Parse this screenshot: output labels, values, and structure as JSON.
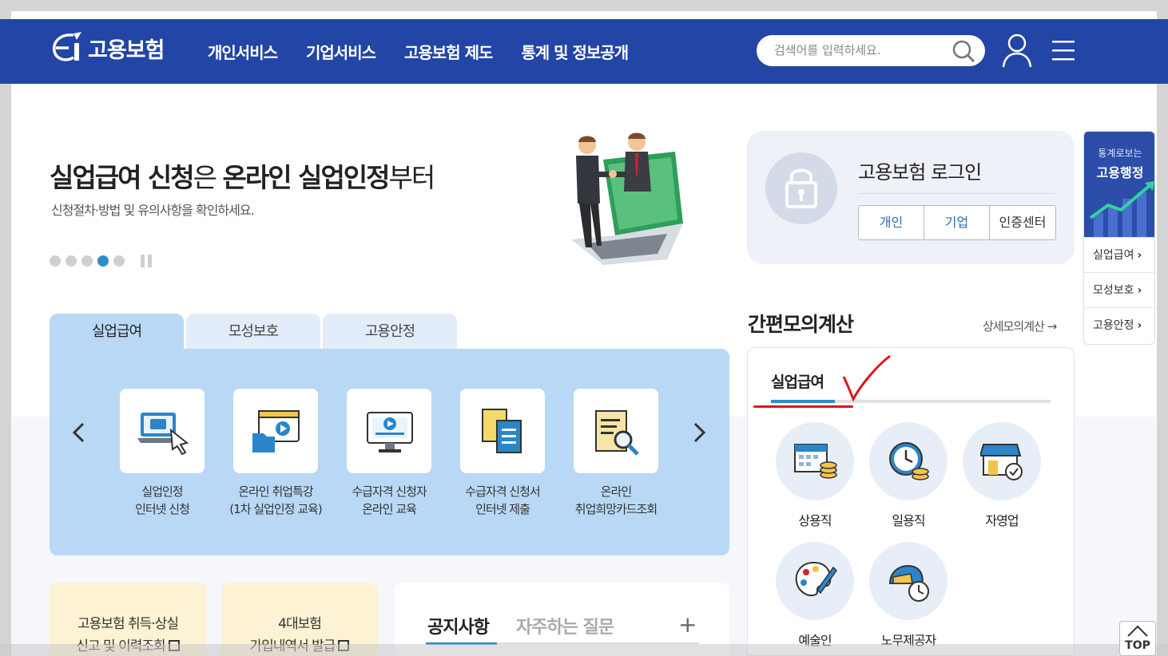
{
  "header": {
    "logo_text": "고용보험",
    "nav": [
      "개인서비스",
      "기업서비스",
      "고용보험 제도",
      "통계 및 정보공개"
    ],
    "search_placeholder": "검색어를 입력하세요.",
    "bg_color": "#2245a6"
  },
  "hero": {
    "title_bold_1": "실업급여 신청",
    "title_light_1": "은 ",
    "title_bold_2": "온라인 실업인정",
    "title_light_2": "부터",
    "subtitle": "신청절차·방법 및 유의사항을 확인하세요.",
    "slide_count": 5,
    "active_slide": 4
  },
  "login": {
    "title": "고용보험 로그인",
    "buttons": [
      "개인",
      "기업",
      "인증센터"
    ]
  },
  "quick": {
    "banner_line1": "통계로보는",
    "banner_line2": "고용행정",
    "items": [
      "실업급여",
      "모성보호",
      "고용안정"
    ]
  },
  "service_tabs": {
    "tabs": [
      "실업급여",
      "모성보호",
      "고용안정"
    ],
    "active": 0,
    "cards": [
      {
        "label": "실업인정\n인터넷 신청",
        "icon": "laptop-click-icon"
      },
      {
        "label": "온라인 취업특강\n(1차 실업인정 교육)",
        "icon": "video-folder-icon"
      },
      {
        "label": "수급자격 신청자\n온라인 교육",
        "icon": "monitor-play-icon"
      },
      {
        "label": "수급자격 신청서\n인터넷 제출",
        "icon": "documents-icon"
      },
      {
        "label": "온라인\n취업희망카드조회",
        "icon": "document-search-icon"
      }
    ]
  },
  "simulator": {
    "title": "간편모의계산",
    "more": "상세모의계산",
    "tab": "실업급여",
    "items": [
      {
        "label": "상용직",
        "icon": "calendar-coins-icon"
      },
      {
        "label": "일용직",
        "icon": "clock-coins-icon"
      },
      {
        "label": "자영업",
        "icon": "store-icon"
      },
      {
        "label": "예술인",
        "icon": "palette-icon"
      },
      {
        "label": "노무제공자",
        "icon": "helmet-clock-icon"
      }
    ]
  },
  "bottom": {
    "card1_line1": "고용보험 취득·상실",
    "card1_line2": "신고 및 이력조회",
    "card2_line1": "4대보험",
    "card2_line2": "가입내역서 발급",
    "notice_tab": "공지사항",
    "faq_tab": "자주하는 질문",
    "plus": "+",
    "top_btn": "TOP"
  }
}
